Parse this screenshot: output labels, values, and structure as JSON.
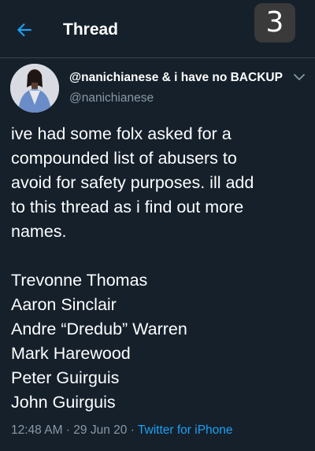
{
  "header": {
    "title": "Thread",
    "page_badge": "3"
  },
  "tweet": {
    "display_name": "@nanichianese & i have no BACKUP",
    "handle": "@nanichianese",
    "text_lines": [
      "ive had some folx asked for a",
      "compounded list of abusers to",
      "avoid for safety purposes. ill add",
      "to this thread as i find out more",
      "names."
    ],
    "names": [
      "Trevonne Thomas",
      "Aaron Sinclair",
      "Andre “Dredub” Warren",
      "Mark Harewood",
      "Peter Guirguis",
      "John Guirguis"
    ],
    "time": "12:48 AM",
    "separator": "·",
    "date": "29 Jun 20",
    "source": "Twitter for iPhone"
  },
  "colors": {
    "background": "#15202b",
    "accent": "#1da1f2",
    "secondary_text": "#8899a6"
  },
  "icons": {
    "back": "back-arrow-icon",
    "more": "chevron-down-icon"
  }
}
